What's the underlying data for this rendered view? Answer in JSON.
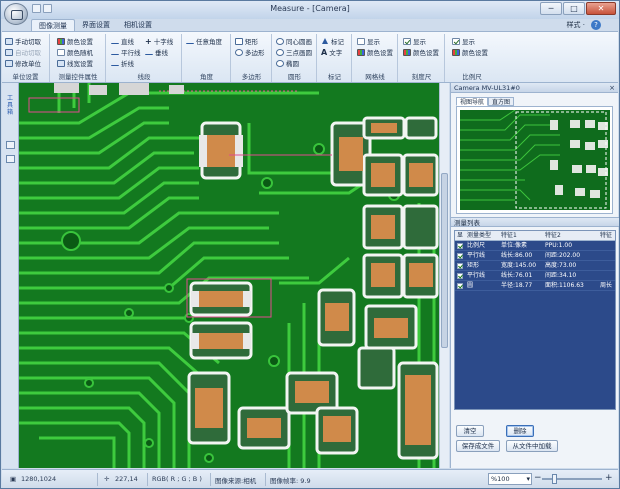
{
  "window": {
    "title": "Measure - [Camera]",
    "min": "─",
    "max": "□",
    "close": "✕"
  },
  "tabs": [
    "图像测量",
    "界面设置",
    "相机设置"
  ],
  "style_label": "样式 ·",
  "help": "?",
  "ribbon": {
    "groups": [
      {
        "label": "单位设置",
        "items": [
          "手动切取",
          "自动切取",
          "修改单位"
        ]
      },
      {
        "label": "测量控件属性",
        "items": [
          "颜色设置",
          "颜色随机",
          "线宽设置"
        ]
      },
      {
        "label": "线段",
        "items": [
          "直线",
          "平行线",
          "折线",
          "十字线",
          "垂线"
        ]
      },
      {
        "label": "角度",
        "items": [
          "任意角度"
        ]
      },
      {
        "label": "多边形",
        "items": [
          "矩形",
          "多边形"
        ]
      },
      {
        "label": "圆形",
        "items": [
          "同心圆画",
          "三点画圆",
          "椭圆"
        ]
      },
      {
        "label": "标记",
        "items": [
          "标记",
          "文字"
        ]
      },
      {
        "label": "网格线",
        "items": [
          "显示",
          "颜色设置"
        ]
      },
      {
        "label": "刻度尺",
        "items": [
          "显示",
          "颜色设置"
        ]
      },
      {
        "label": "比例尺",
        "items": [
          "显示",
          "颜色设置"
        ]
      }
    ]
  },
  "leftbar": {
    "vertical_text": "工具箱"
  },
  "panel": {
    "title": "Camera MV-UL31#0",
    "close": "×",
    "nav_tabs": [
      "视图导航",
      "直方图"
    ],
    "list_title": "测量列表",
    "columns": [
      "显",
      "测量类型",
      "特征1",
      "特征2",
      "特征"
    ],
    "rows": [
      {
        "type": "比例尺",
        "f1": "单位:像素",
        "f2": "PPU:1.00",
        "f3": ""
      },
      {
        "type": "平行线",
        "f1": "线长:86.00",
        "f2": "间距:202.00",
        "f3": ""
      },
      {
        "type": "矩形",
        "f1": "宽度:145.00",
        "f2": "高度:73.00",
        "f3": ""
      },
      {
        "type": "平行线",
        "f1": "线长:76.01",
        "f2": "间距:34.10",
        "f3": ""
      },
      {
        "type": "圆",
        "f1": "半径:18.77",
        "f2": "面积:1106.63",
        "f3": "周长"
      }
    ],
    "buttons": {
      "clear": "清空",
      "delete": "删除",
      "save": "保存成文件",
      "load": "从文件中加载"
    }
  },
  "status": {
    "resolution": "1280,1024",
    "coords": "227,14",
    "rgb": "RGB( R ; G ; B )",
    "source": "图像来源:相机",
    "fps": "图像帧率: 9.9",
    "zoom": "%100"
  },
  "colors": {
    "pcb_green": "#1a8a22",
    "trace": "#39c43c",
    "pad_white": "#e8eee8",
    "ribbon_bg": "#dbe6f3",
    "list_bg": "#2c4a8a"
  }
}
